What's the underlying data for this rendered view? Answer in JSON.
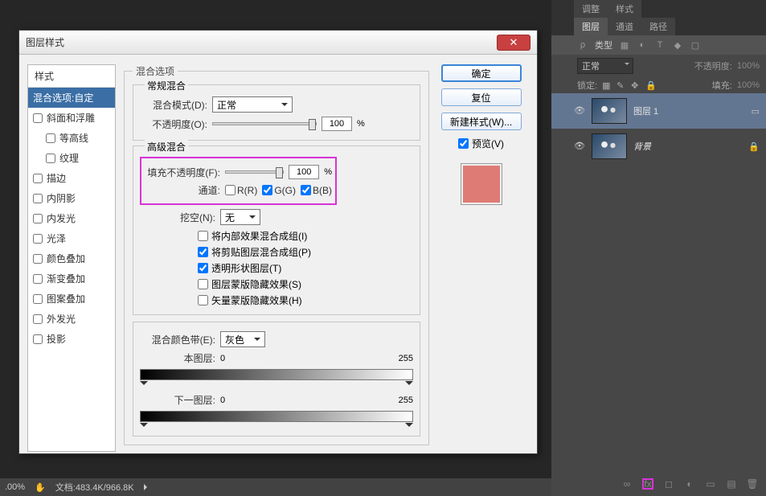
{
  "dialog": {
    "title": "图层样式",
    "close": "✕",
    "sidebar": {
      "header": "样式",
      "items": [
        {
          "label": "混合选项:自定",
          "active": true,
          "cb": false
        },
        {
          "label": "斜面和浮雕",
          "cb": true
        },
        {
          "label": "等高线",
          "cb": true,
          "sub": true
        },
        {
          "label": "纹理",
          "cb": true,
          "sub": true
        },
        {
          "label": "描边",
          "cb": true
        },
        {
          "label": "内阴影",
          "cb": true
        },
        {
          "label": "内发光",
          "cb": true
        },
        {
          "label": "光泽",
          "cb": true
        },
        {
          "label": "颜色叠加",
          "cb": true
        },
        {
          "label": "渐变叠加",
          "cb": true
        },
        {
          "label": "图案叠加",
          "cb": true
        },
        {
          "label": "外发光",
          "cb": true
        },
        {
          "label": "投影",
          "cb": true
        }
      ]
    },
    "fs1": {
      "legend": "混合选项",
      "sub": "常规混合",
      "modeL": "混合模式(D):",
      "mode": "正常",
      "opL": "不透明度(O):",
      "op": "100",
      "pct": "%"
    },
    "fs2": {
      "legend": "高级混合",
      "fillL": "填充不透明度(F):",
      "fill": "100",
      "pct": "%",
      "chanL": "通道:",
      "r": "R(R)",
      "g": "G(G)",
      "b": "B(B)",
      "knockL": "挖空(N):",
      "knock": "无",
      "opts": [
        "将内部效果混合成组(I)",
        "将剪贴图层混合成组(P)",
        "透明形状图层(T)",
        "图层蒙版隐藏效果(S)",
        "矢量蒙版隐藏效果(H)"
      ],
      "checked": [
        false,
        true,
        true,
        false,
        false
      ]
    },
    "fs3": {
      "legend": "",
      "blendifL": "混合颜色带(E):",
      "blendif": "灰色",
      "thisL": "本图层:",
      "underL": "下一图层:",
      "v0": "0",
      "v255": "255"
    },
    "buttons": {
      "ok": "确定",
      "reset": "复位",
      "newstyle": "新建样式(W)...",
      "preview": "预览(V)"
    }
  },
  "right": {
    "tabs1": [
      "调整",
      "样式"
    ],
    "tabs2": [
      "图层",
      "通道",
      "路径"
    ],
    "kind": "类型",
    "blend": "正常",
    "opL": "不透明度:",
    "op": "100%",
    "lockL": "锁定:",
    "fillL": "填充:",
    "fill": "100%",
    "layers": [
      {
        "name": "图层 1",
        "italic": false
      },
      {
        "name": "背景",
        "italic": true
      }
    ],
    "footerIcons": [
      "∞",
      "fx",
      "◻",
      "◐",
      "▭",
      "▤",
      "🗑"
    ]
  },
  "status": {
    "zoom": ".00%",
    "doc": "文档:483.4K/966.8K"
  }
}
